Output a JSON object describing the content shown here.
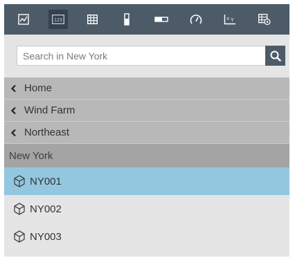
{
  "toolbar": {
    "buttons": [
      {
        "icon": "line-chart-icon"
      },
      {
        "icon": "numeric-value-icon",
        "active": true
      },
      {
        "icon": "table-icon"
      },
      {
        "icon": "vertical-gauge-icon"
      },
      {
        "icon": "horizontal-gauge-icon"
      },
      {
        "icon": "radial-gauge-icon"
      },
      {
        "icon": "xy-plot-icon"
      },
      {
        "icon": "asset-table-icon"
      }
    ],
    "active_color": "#34414e",
    "background": "#4d5b69"
  },
  "search": {
    "placeholder": "Search in New York",
    "button_icon": "search-icon"
  },
  "breadcrumbs": [
    {
      "label": "Home"
    },
    {
      "label": "Wind Farm"
    },
    {
      "label": "Northeast"
    }
  ],
  "current": {
    "label": "New York"
  },
  "assets": [
    {
      "label": "NY001",
      "selected": true,
      "icon": "cube-icon"
    },
    {
      "label": "NY002",
      "selected": false,
      "icon": "cube-icon"
    },
    {
      "label": "NY003",
      "selected": false,
      "icon": "cube-icon"
    }
  ],
  "colors": {
    "selected_row": "#93c7e0",
    "breadcrumb": "#b8b8b8",
    "current": "#a4a4a4"
  }
}
